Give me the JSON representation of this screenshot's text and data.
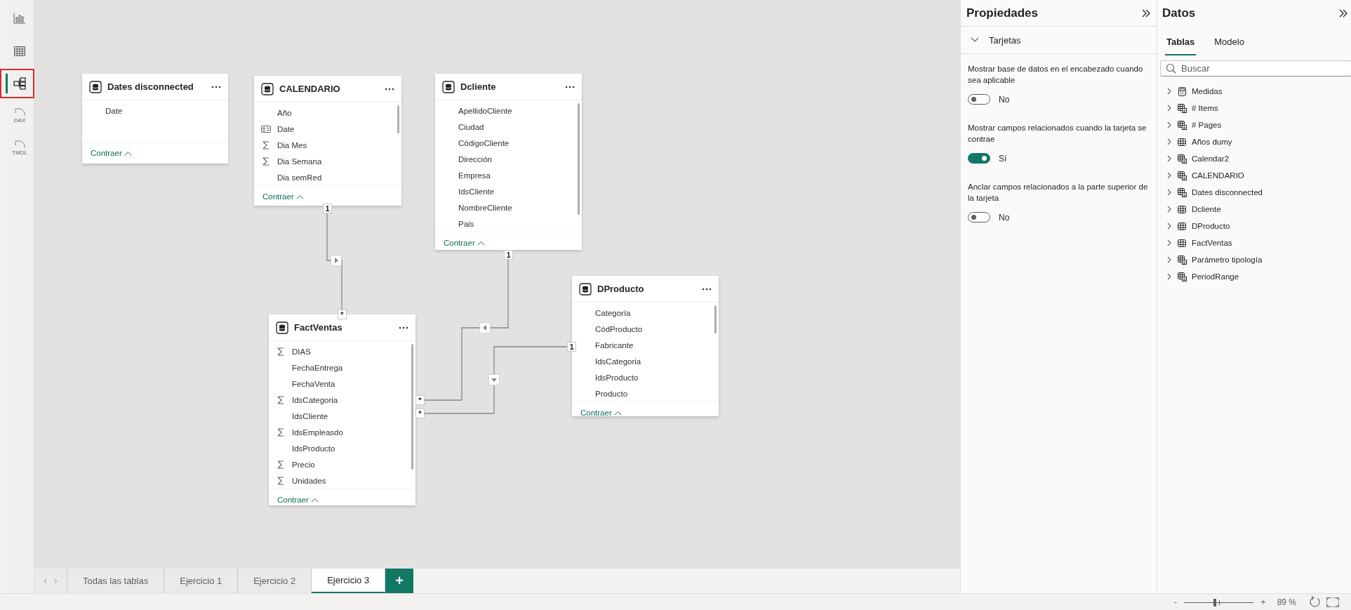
{
  "rail": {
    "items": [
      {
        "kind": "report",
        "selected": false,
        "highlighted": false
      },
      {
        "kind": "table",
        "selected": false,
        "highlighted": false
      },
      {
        "kind": "model",
        "selected": true,
        "highlighted": true
      },
      {
        "kind": "dax",
        "label": "DAX",
        "selected": false,
        "highlighted": false
      },
      {
        "kind": "tmdl",
        "label": "TMDL",
        "selected": false,
        "highlighted": false
      }
    ]
  },
  "canvas": {
    "cards": [
      {
        "title": "Dates disconnected",
        "fields": [
          {
            "name": "Date",
            "kind": "column"
          }
        ],
        "footer": "Contraer"
      },
      {
        "title": "CALENDARIO",
        "fields": [
          {
            "name": "Año",
            "kind": "column"
          },
          {
            "name": "Date",
            "kind": "hierarchy"
          },
          {
            "name": "Dia Mes",
            "kind": "sum"
          },
          {
            "name": "Dia Semana",
            "kind": "sum"
          },
          {
            "name": "Dia semRed",
            "kind": "column"
          }
        ],
        "footer": "Contraer"
      },
      {
        "title": "Dcliente",
        "fields": [
          {
            "name": "ApellidoCliente",
            "kind": "column"
          },
          {
            "name": "Ciudad",
            "kind": "column"
          },
          {
            "name": "CódigoCliente",
            "kind": "column"
          },
          {
            "name": "Dirección",
            "kind": "column"
          },
          {
            "name": "Empresa",
            "kind": "column"
          },
          {
            "name": "IdsCliente",
            "kind": "column"
          },
          {
            "name": "NombreCliente",
            "kind": "column"
          },
          {
            "name": "Pais",
            "kind": "column"
          }
        ],
        "footer": "Contraer"
      },
      {
        "title": "DProducto",
        "fields": [
          {
            "name": "Categoría",
            "kind": "column"
          },
          {
            "name": "CódProducto",
            "kind": "column"
          },
          {
            "name": "Fabricante",
            "kind": "column"
          },
          {
            "name": "IdsCategoria",
            "kind": "column"
          },
          {
            "name": "IdsProducto",
            "kind": "column"
          },
          {
            "name": "Producto",
            "kind": "column"
          }
        ],
        "footer": "Contraer"
      },
      {
        "title": "FactVentas",
        "fields": [
          {
            "name": "DIAS",
            "kind": "sum"
          },
          {
            "name": "FechaEntrega",
            "kind": "column"
          },
          {
            "name": "FechaVenta",
            "kind": "column"
          },
          {
            "name": "IdsCategoria",
            "kind": "sum"
          },
          {
            "name": "IdsCliente",
            "kind": "column"
          },
          {
            "name": "IdsEmpleasdo",
            "kind": "sum"
          },
          {
            "name": "IdsProducto",
            "kind": "column"
          },
          {
            "name": "Precio",
            "kind": "sum"
          },
          {
            "name": "Unidades",
            "kind": "sum"
          }
        ],
        "footer": "Contraer"
      }
    ],
    "relationships": [
      {
        "one_label": "1",
        "many_label": "*"
      },
      {
        "one_label": "1",
        "many_label": "*"
      },
      {
        "one_label": "1",
        "many_label": "*"
      }
    ]
  },
  "page_tabs": {
    "items": [
      {
        "label": "Todas las tablas",
        "selected": false
      },
      {
        "label": "Ejercicio 1",
        "selected": false
      },
      {
        "label": "Ejercicio 2",
        "selected": false
      },
      {
        "label": "Ejercicio 3",
        "selected": true
      }
    ],
    "add_button": "+"
  },
  "properties": {
    "title": "Propiedades",
    "section": {
      "label": "Tarjetas",
      "expanded": true
    },
    "settings": [
      {
        "label": "Mostrar base de datos en el encabezado cuando sea aplicable",
        "on": false,
        "value": "No"
      },
      {
        "label": "Mostrar campos relacionados cuando la tarjeta se contrae",
        "on": true,
        "value": "Sí"
      },
      {
        "label": "Anclar campos relacionados a la parte superior de la tarjeta",
        "on": false,
        "value": "No"
      }
    ]
  },
  "data": {
    "title": "Datos",
    "tabs": [
      {
        "label": "Tablas",
        "selected": true
      },
      {
        "label": "Modelo",
        "selected": false
      }
    ],
    "search": {
      "placeholder": "Buscar"
    },
    "tables": [
      {
        "name": "Medidas",
        "kind": "measures",
        "expanded": false
      },
      {
        "name": "# Items",
        "kind": "calculated",
        "expanded": false
      },
      {
        "name": "# Pages",
        "kind": "calculated",
        "expanded": false
      },
      {
        "name": "Años dumy",
        "kind": "table",
        "expanded": false
      },
      {
        "name": "Calendar2",
        "kind": "calculated",
        "expanded": false
      },
      {
        "name": "CALENDARIO",
        "kind": "calculated",
        "expanded": false
      },
      {
        "name": "Dates disconnected",
        "kind": "calculated",
        "expanded": false
      },
      {
        "name": "Dcliente",
        "kind": "table",
        "expanded": false
      },
      {
        "name": "DProducto",
        "kind": "table",
        "expanded": false
      },
      {
        "name": "FactVentas",
        "kind": "table",
        "expanded": false
      },
      {
        "name": "Parámetro tipología",
        "kind": "calculated",
        "expanded": false
      },
      {
        "name": "PeriodRange",
        "kind": "calculated",
        "expanded": false
      }
    ]
  },
  "status_bar": {
    "zoom_out": "-",
    "zoom_in": "+",
    "zoom": {
      "level": 0.44
    },
    "zoom_reading": "89 %"
  }
}
